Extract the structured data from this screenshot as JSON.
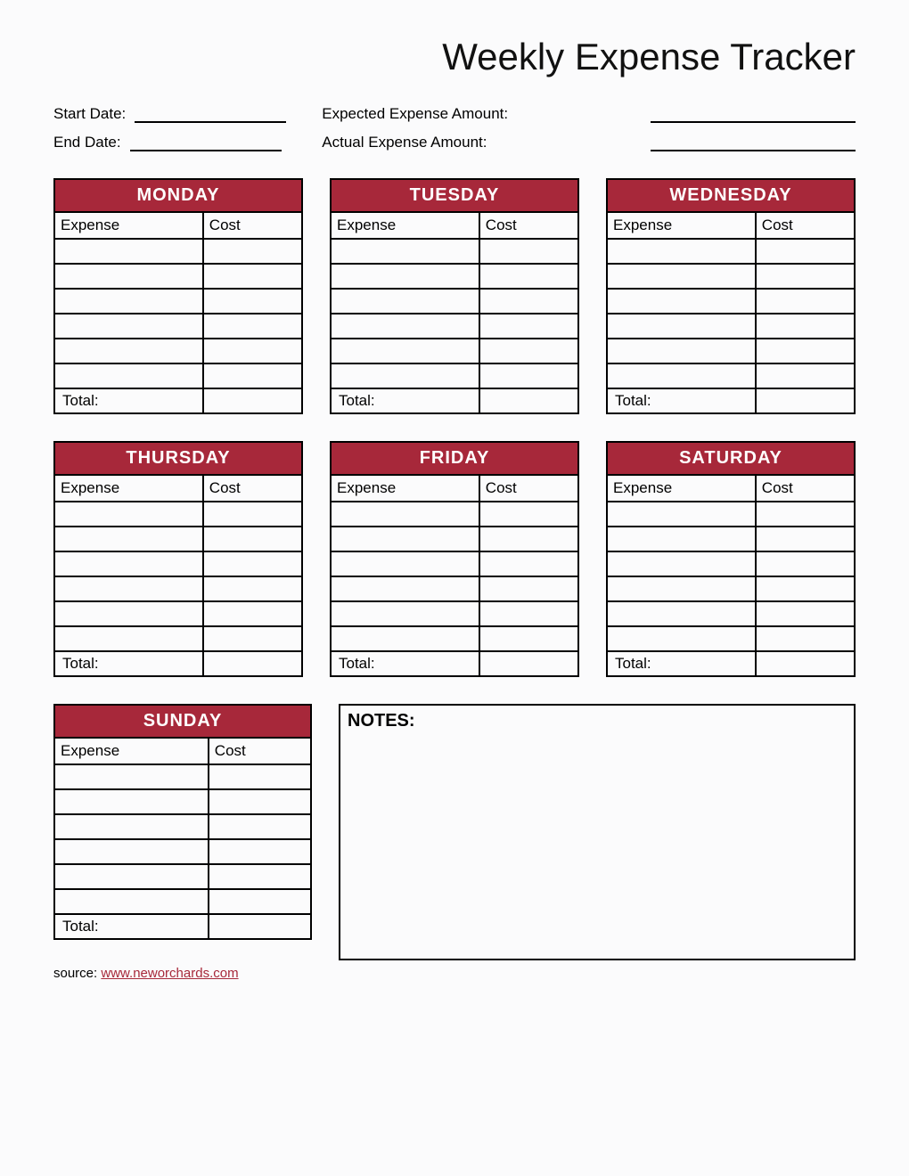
{
  "title": "Weekly Expense Tracker",
  "meta": {
    "start_date_label": "Start Date:",
    "end_date_label": "End Date:",
    "expected_label": "Expected Expense Amount:",
    "actual_label": "Actual Expense Amount:",
    "start_date_value": "",
    "end_date_value": "",
    "expected_value": "",
    "actual_value": ""
  },
  "columns": {
    "expense": "Expense",
    "cost": "Cost"
  },
  "total_label": "Total:",
  "days": [
    {
      "name": "MONDAY",
      "rows": [
        [
          "",
          ""
        ],
        [
          "",
          ""
        ],
        [
          "",
          ""
        ],
        [
          "",
          ""
        ],
        [
          "",
          ""
        ],
        [
          "",
          ""
        ]
      ],
      "total": ""
    },
    {
      "name": "TUESDAY",
      "rows": [
        [
          "",
          ""
        ],
        [
          "",
          ""
        ],
        [
          "",
          ""
        ],
        [
          "",
          ""
        ],
        [
          "",
          ""
        ],
        [
          "",
          ""
        ]
      ],
      "total": ""
    },
    {
      "name": "WEDNESDAY",
      "rows": [
        [
          "",
          ""
        ],
        [
          "",
          ""
        ],
        [
          "",
          ""
        ],
        [
          "",
          ""
        ],
        [
          "",
          ""
        ],
        [
          "",
          ""
        ]
      ],
      "total": ""
    },
    {
      "name": "THURSDAY",
      "rows": [
        [
          "",
          ""
        ],
        [
          "",
          ""
        ],
        [
          "",
          ""
        ],
        [
          "",
          ""
        ],
        [
          "",
          ""
        ],
        [
          "",
          ""
        ]
      ],
      "total": ""
    },
    {
      "name": "FRIDAY",
      "rows": [
        [
          "",
          ""
        ],
        [
          "",
          ""
        ],
        [
          "",
          ""
        ],
        [
          "",
          ""
        ],
        [
          "",
          ""
        ],
        [
          "",
          ""
        ]
      ],
      "total": ""
    },
    {
      "name": "SATURDAY",
      "rows": [
        [
          "",
          ""
        ],
        [
          "",
          ""
        ],
        [
          "",
          ""
        ],
        [
          "",
          ""
        ],
        [
          "",
          ""
        ],
        [
          "",
          ""
        ]
      ],
      "total": ""
    },
    {
      "name": "SUNDAY",
      "rows": [
        [
          "",
          ""
        ],
        [
          "",
          ""
        ],
        [
          "",
          ""
        ],
        [
          "",
          ""
        ],
        [
          "",
          ""
        ],
        [
          "",
          ""
        ]
      ],
      "total": ""
    }
  ],
  "notes_label": "NOTES:",
  "notes_content": "",
  "source_prefix": "source: ",
  "source_text": "www.neworchards.com"
}
